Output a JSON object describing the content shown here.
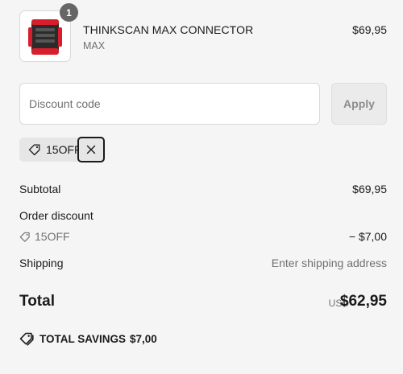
{
  "product": {
    "quantity": "1",
    "name": "THINKSCAN MAX CONNECTOR",
    "variant": "MAX",
    "price": "$69,95",
    "image_icon": "obd-connector-device-image"
  },
  "discount": {
    "placeholder": "Discount code",
    "value": "",
    "apply_label": "Apply",
    "applied_code": "15OFF",
    "remove_icon": "close-icon"
  },
  "summary": {
    "subtotal_label": "Subtotal",
    "subtotal_value": "$69,95",
    "order_discount_label": "Order discount",
    "order_discount_code": "15OFF",
    "order_discount_value": "− $7,00",
    "shipping_label": "Shipping",
    "shipping_value": "Enter shipping address",
    "total_label": "Total",
    "total_currency": "USD",
    "total_value": "$62,95",
    "savings_label": "TOTAL SAVINGS",
    "savings_value": "$7,00"
  },
  "colors": {
    "background": "#f5f5f5",
    "text": "#1a1a1a",
    "muted": "#707070",
    "badge": "#666666",
    "product_accent_red": "#d81e2c"
  }
}
